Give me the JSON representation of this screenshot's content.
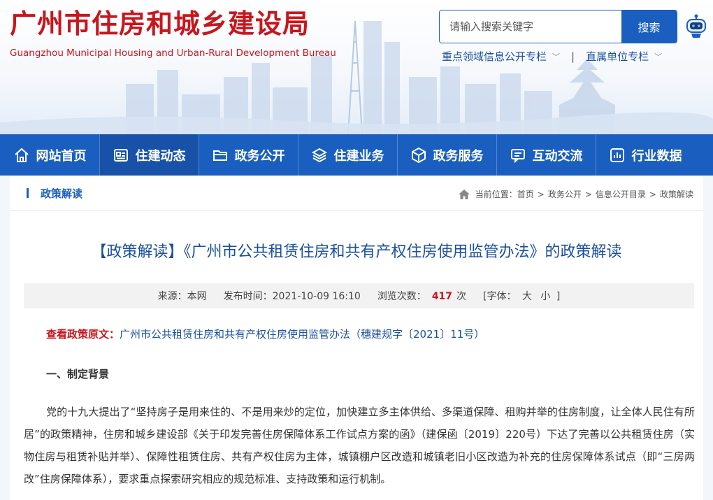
{
  "header": {
    "title": "广州市住房和城乡建设局",
    "subtitle": "Guangzhou Municipal Housing and Urban-Rural Development Bureau",
    "search": {
      "placeholder": "请输入搜索关键字",
      "button_label": "搜索"
    },
    "links": [
      {
        "label": "重点领域信息公开专栏"
      },
      {
        "label": "直属单位专栏"
      }
    ],
    "link_separator": "|"
  },
  "nav": {
    "items": [
      {
        "label": "网站首页",
        "icon": "home-icon"
      },
      {
        "label": "住建动态",
        "icon": "news-icon"
      },
      {
        "label": "政务公开",
        "icon": "folder-icon"
      },
      {
        "label": "住建业务",
        "icon": "layers-icon"
      },
      {
        "label": "政务服务",
        "icon": "box-icon"
      },
      {
        "label": "互动交流",
        "icon": "chat-icon"
      },
      {
        "label": "行业数据",
        "icon": "chart-icon"
      }
    ],
    "active_index": 1
  },
  "breadcrumb": {
    "section": "政策解读",
    "prefix": "当前位置：",
    "items": [
      "首页",
      "政务公开",
      "信息公开目录",
      "政策解读"
    ],
    "separator": ">"
  },
  "article": {
    "title": "【政策解读】《广州市公共租赁住房和共有产权住房使用监管办法》的政策解读",
    "meta": {
      "source_label": "来源：",
      "source": "本网",
      "time_label": "发布时间：",
      "time": "2021-10-09 16:10",
      "views_label": "浏览次数：",
      "views": "417",
      "views_unit": "次",
      "font_label": "[字体：",
      "font_large": "大",
      "font_small": "小",
      "font_close": "]"
    },
    "original": {
      "label": "查看政策原文：",
      "link": "广州市公共租赁住房和共有产权住房使用监管办法（穗建规字〔2021〕11号）"
    },
    "heading1": "一、制定背景",
    "paragraph1": "党的十九大提出了“坚持房子是用来住的、不是用来炒的定位，加快建立多主体供给、多渠道保障、租购并举的住房制度，让全体人民住有所居”的政策精神，住房和城乡建设部《关于印发完善住房保障体系工作试点方案的函》（建保函〔2019〕220号）下达了完善以公共租赁住房（实物住房与租赁补贴并举）、保障性租赁住房、共有产权住房为主体，城镇棚户区改造和城镇老旧小区改造为补充的住房保障体系试点（即“三房两改”住房保障体系），要求重点探索研究相应的规范标准、支持政策和运行机制。"
  },
  "colors": {
    "brand_red": "#c8161d",
    "nav_blue": "#1a5fbf",
    "link_blue": "#1a4f9c"
  }
}
